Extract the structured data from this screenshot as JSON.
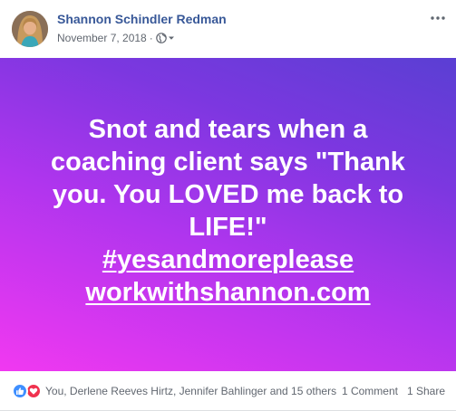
{
  "post": {
    "author": "Shannon Schindler Redman",
    "date": "November 7, 2018",
    "separator": "·",
    "privacy_icon": "globe-icon",
    "menu_icon": "more-horizontal-icon"
  },
  "card": {
    "background_colors": [
      "#f138f1",
      "#b035ee",
      "#7c37e0",
      "#5a3fd3"
    ],
    "lines": [
      "Snot and tears when a",
      "coaching client says \"Thank",
      "you. You LOVED me back to",
      "LIFE!\""
    ],
    "hashtag": "#yesandmoreplease",
    "link": "workwithshannon.com"
  },
  "footer": {
    "reaction_icons": [
      "like-icon",
      "love-icon"
    ],
    "reactions_text": "You, Derlene Reeves Hirtz, Jennifer Bahlinger and 15 others",
    "comments": "1 Comment",
    "shares": "1 Share"
  },
  "colors": {
    "author_link": "#385898",
    "meta_text": "#616770",
    "like_blue": "#3f8fff",
    "love_red": "#f0324f"
  }
}
